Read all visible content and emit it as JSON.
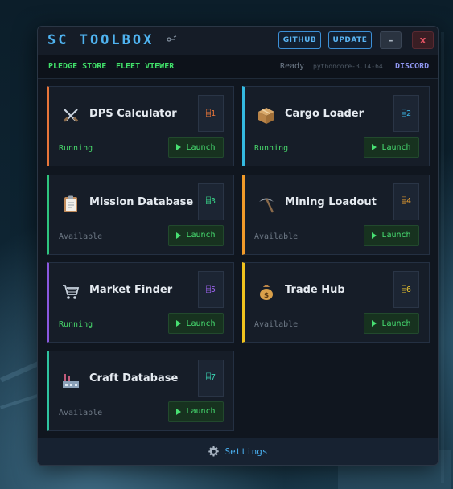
{
  "window": {
    "title": "SC TOOLBOX",
    "github_label": "GITHUB",
    "update_label": "UPDATE",
    "minimize_label": "–",
    "close_label": "x"
  },
  "nav": {
    "pledge_store": "PLEDGE STORE",
    "fleet_viewer": "FLEET VIEWER",
    "status": "Ready",
    "version": "pythoncore-3.14-64",
    "discord": "DISCORD"
  },
  "launch_label": "Launch",
  "tools": [
    {
      "name": "DPS Calculator",
      "hotkey": "⌸1",
      "state": "Running",
      "accent": "#e8753a",
      "badge_color": "#e8753a",
      "state_color": "#47d46a",
      "icon": "crossed-swords-icon"
    },
    {
      "name": "Cargo Loader",
      "hotkey": "⌸2",
      "state": "Running",
      "accent": "#34b9e0",
      "badge_color": "#3ab6e6",
      "state_color": "#47d46a",
      "icon": "package-icon"
    },
    {
      "name": "Mission Database",
      "hotkey": "⌸3",
      "state": "Available",
      "accent": "#2ec47e",
      "badge_color": "#38d489",
      "state_color": "#6f7a87",
      "icon": "clipboard-icon"
    },
    {
      "name": "Mining Loadout",
      "hotkey": "⌸4",
      "state": "Available",
      "accent": "#f09a2a",
      "badge_color": "#f0a22f",
      "state_color": "#6f7a87",
      "icon": "pickaxe-icon"
    },
    {
      "name": "Market Finder",
      "hotkey": "⌸5",
      "state": "Running",
      "accent": "#8a58e0",
      "badge_color": "#9b62ec",
      "state_color": "#47d46a",
      "icon": "shopping-cart-icon"
    },
    {
      "name": "Trade Hub",
      "hotkey": "⌸6",
      "state": "Available",
      "accent": "#f0c21e",
      "badge_color": "#f0c82e",
      "state_color": "#6f7a87",
      "icon": "money-bag-icon"
    },
    {
      "name": "Craft Database",
      "hotkey": "⌸7",
      "state": "Available",
      "accent": "#2ec4a0",
      "badge_color": "#3ad0b0",
      "state_color": "#6f7a87",
      "icon": "factory-icon"
    }
  ],
  "footer": {
    "settings_label": "Settings",
    "icon": "gear-icon"
  }
}
